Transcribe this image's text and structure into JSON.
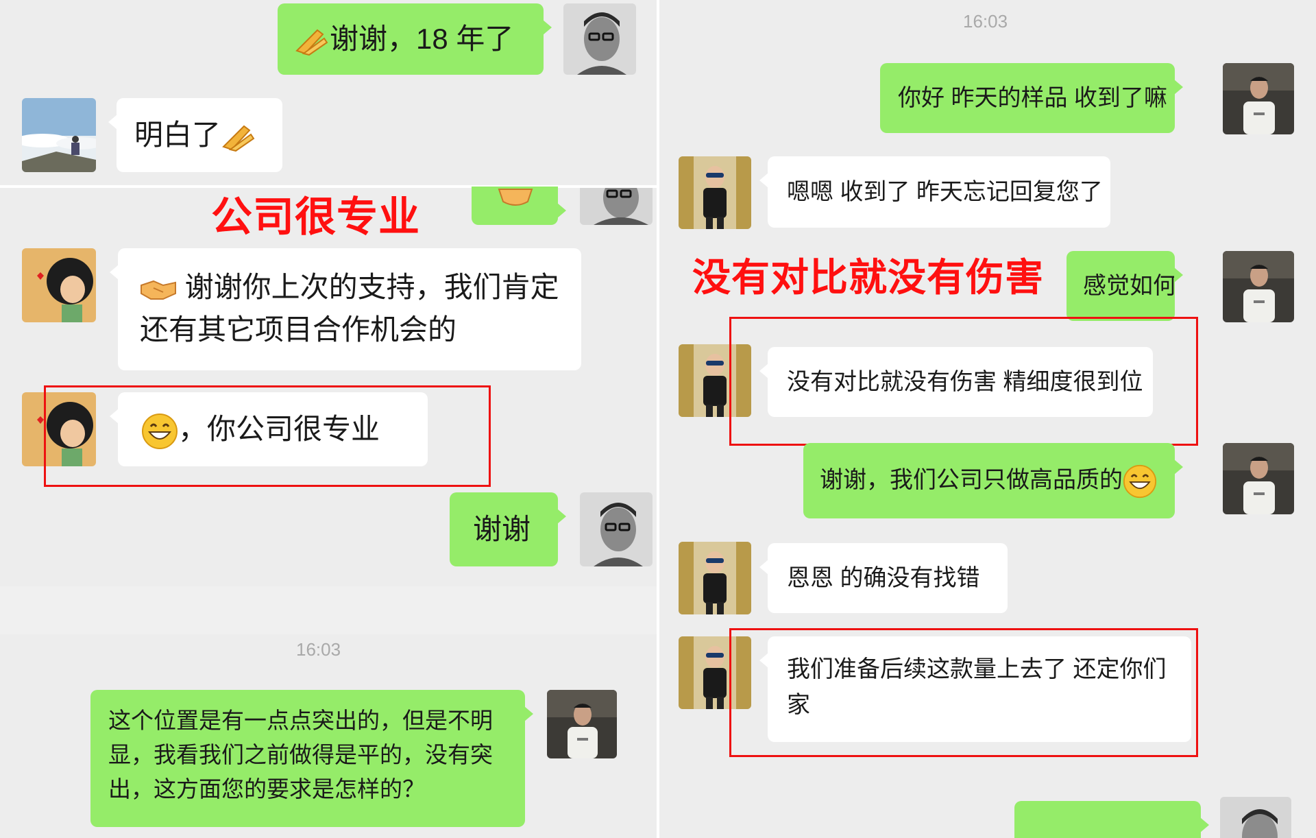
{
  "left": {
    "messages": {
      "thanks_18": "谢谢，18 年了",
      "understood": "明白了",
      "support": "谢谢你上次的支持，我们肯定还有其它项目合作机会的",
      "praise": "，你公司很专业",
      "thanks": "谢谢",
      "question": "这个位置是有一点点突出的，但是不明显，我看我们之前做得是平的，没有突出，这方面您的要求是怎样的？"
    },
    "timestamp": "16:03",
    "caption": "公司很专业"
  },
  "right": {
    "timestamp": "16:03",
    "messages": {
      "hello": "你好 昨天的样品 收到了嘛",
      "received": "嗯嗯 收到了 昨天忘记回复您了",
      "feeling": "感觉如何",
      "no_compare": "没有对比就没有伤害 精细度很到位",
      "thanks_quality": "谢谢，我们公司只做高品质的",
      "indeed": "恩恩 的确没有找错",
      "order": "我们准备后续这款量上去了 还定你们家"
    },
    "caption": "没有对比就没有伤害"
  },
  "icons": {
    "clap": "clap-icon",
    "handshake": "handshake-icon",
    "grin": "grin-emoji-icon"
  },
  "colors": {
    "sent_bubble": "#95ec69",
    "received_bubble": "#ffffff",
    "chat_background": "#ededed",
    "annotation_red": "#ff1010"
  }
}
